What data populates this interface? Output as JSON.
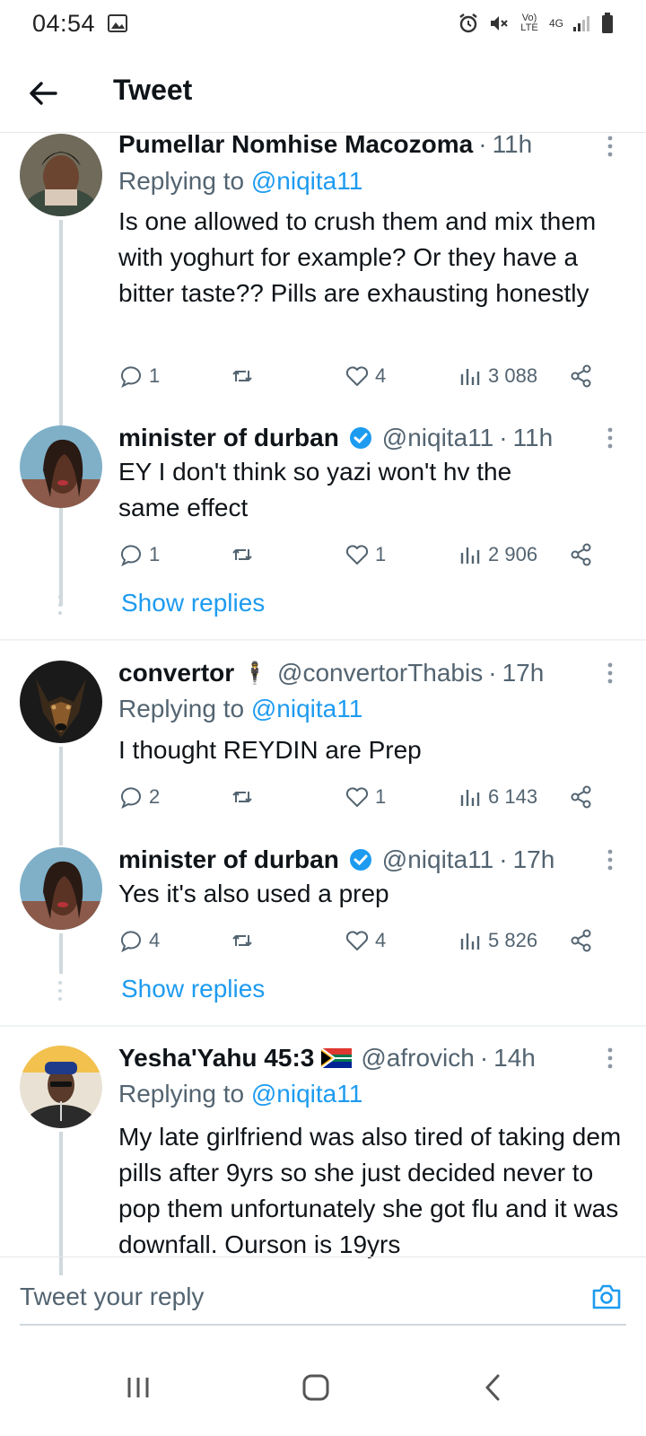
{
  "status": {
    "time": "04:54",
    "network_label": "4G",
    "volte_label": "Vo) LTE"
  },
  "header": {
    "title": "Tweet"
  },
  "tweets": [
    {
      "name": "Pumellar Nomhise Macozoma",
      "handle": "",
      "time": "11h",
      "replying_prefix": "Replying to",
      "replying_to": "@niqita11",
      "text": "Is one allowed to crush them and mix them with yoghurt for example? Or they have a bitter taste?? Pills are exhausting honestly",
      "replies": "1",
      "retweets": "",
      "likes": "4",
      "views": "3 088"
    },
    {
      "name": "minister of durban",
      "handle": "@niqita11",
      "time": "11h",
      "text": "EY I don't think so yazi won't hv the same effect",
      "replies": "1",
      "retweets": "",
      "likes": "1",
      "views": "2 906"
    },
    {
      "name": "convertor",
      "handle": "@convertorThabis",
      "time": "17h",
      "replying_prefix": "Replying to",
      "replying_to": "@niqita11",
      "text": "I thought REYDIN  are Prep",
      "replies": "2",
      "retweets": "",
      "likes": "1",
      "views": "6 143"
    },
    {
      "name": "minister of durban",
      "handle": "@niqita11",
      "time": "17h",
      "text": "Yes it's also used a prep",
      "replies": "4",
      "retweets": "",
      "likes": "4",
      "views": "5 826"
    },
    {
      "name": "Yesha'Yahu 45:3",
      "handle": "@afrovich",
      "time": "14h",
      "replying_prefix": "Replying to",
      "replying_to": "@niqita11",
      "text": "My late girlfriend was also tired of taking dem pills after 9yrs so she just decided never to pop them unfortunately she got flu and it was downfall. Ourson is 19yrs",
      "replies": "",
      "retweets": "",
      "likes": "",
      "views": ""
    }
  ],
  "show_replies_label": "Show replies",
  "reply_box": {
    "placeholder": "Tweet your reply"
  },
  "colors": {
    "link": "#1d9bf0",
    "muted": "#536471",
    "text": "#0f1419"
  },
  "icons": [
    "back-arrow-icon",
    "reply-icon",
    "retweet-icon",
    "like-icon",
    "views-icon",
    "share-icon",
    "camera-icon",
    "verified-icon"
  ]
}
